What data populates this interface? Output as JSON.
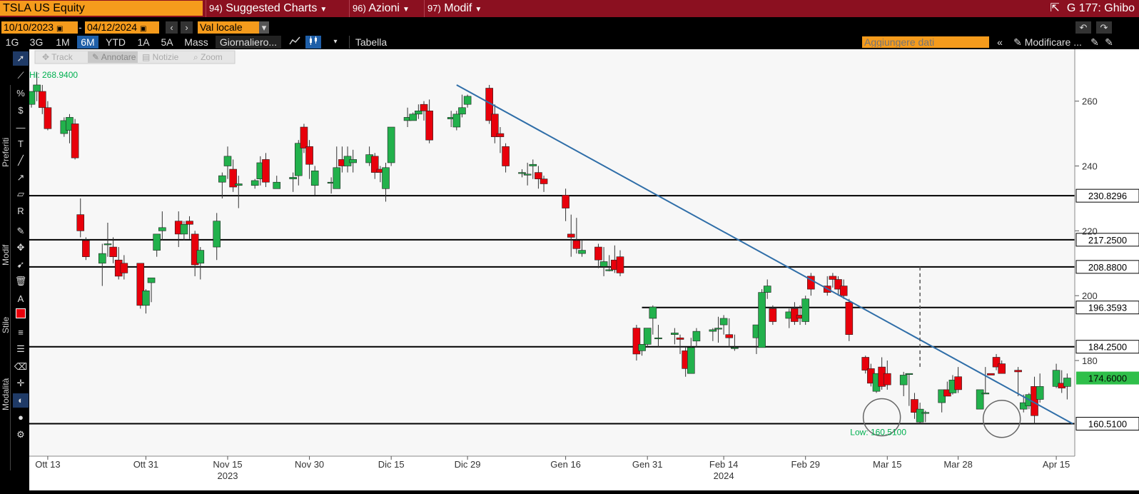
{
  "header": {
    "ticker": "TSLA US Equity",
    "menus": [
      {
        "num": "94)",
        "label": "Suggested Charts"
      },
      {
        "num": "96)",
        "label": "Azioni"
      },
      {
        "num": "97)",
        "label": "Modif"
      }
    ],
    "right_title": "G 177: Ghibo"
  },
  "toolbar": {
    "start_date": "10/10/2023",
    "end_date": "04/12/2024",
    "currency": "Val locale",
    "timeframes": [
      "1G",
      "3G",
      "1M",
      "6M",
      "YTD",
      "1A",
      "5A",
      "Mass"
    ],
    "active_timeframe": "6M",
    "period": "Giornaliero...",
    "table_label": "Tabella",
    "add_data_placeholder": "Aggiungere dati",
    "edit_label": "Modificare ..."
  },
  "annot_tools": [
    "Track",
    "Annotare",
    "Notizie",
    "Zoom"
  ],
  "side_labels": [
    "Preferiti",
    "Modif",
    "Stile",
    "Modalità"
  ],
  "chart_data": {
    "type": "candlestick",
    "x_ticks": [
      {
        "date": "2023-10-13",
        "label": "Ott 13"
      },
      {
        "date": "2023-10-31",
        "label": "Ott 31"
      },
      {
        "date": "2023-11-15",
        "label": "Nov 15"
      },
      {
        "date": "2023-11-30",
        "label": "Nov 30"
      },
      {
        "date": "2023-12-15",
        "label": "Dic 15"
      },
      {
        "date": "2023-12-29",
        "label": "Dic 29"
      },
      {
        "date": "2024-01-16",
        "label": "Gen 16"
      },
      {
        "date": "2024-01-31",
        "label": "Gen 31"
      },
      {
        "date": "2024-02-14",
        "label": "Feb 14"
      },
      {
        "date": "2024-02-29",
        "label": "Feb 29"
      },
      {
        "date": "2024-03-15",
        "label": "Mar 15"
      },
      {
        "date": "2024-03-28",
        "label": "Mar 28"
      },
      {
        "date": "2024-04-15",
        "label": "Apr 15"
      }
    ],
    "year_labels": [
      {
        "date": "2023-11-15",
        "label": "2023"
      },
      {
        "date": "2024-02-14",
        "label": "2024"
      }
    ],
    "y_ticks": [
      180,
      200,
      220,
      240,
      260
    ],
    "ylim": [
      150.5,
      276
    ],
    "xlim": [
      "2023-10-10",
      "2024-04-18"
    ],
    "hi_label": "Hi: 268.9400",
    "low_label": "Low: 160.5100",
    "h_lines": [
      {
        "value": 230.8296,
        "label": "230.8296"
      },
      {
        "value": 217.25,
        "label": "217.2500"
      },
      {
        "value": 208.88,
        "label": "208.8800"
      },
      {
        "value": 184.25,
        "label": "184.2500"
      },
      {
        "value": 160.51,
        "label": "160.5100"
      }
    ],
    "short_line": {
      "value": 196.3593,
      "label": "196.3593",
      "from": "2024-01-30"
    },
    "last_price": {
      "value": 174.6,
      "label": "174.6000"
    },
    "trendline": [
      {
        "date": "2023-12-27",
        "value": 265
      },
      {
        "date": "2024-04-18",
        "value": 160.51
      }
    ],
    "vline": {
      "date": "2024-03-21",
      "from": 208.88,
      "to": 177.5
    },
    "circles": [
      {
        "date": "2024-03-14",
        "value": 162.5
      },
      {
        "date": "2024-04-05",
        "value": 162
      }
    ],
    "candles": [
      {
        "d": "2023-10-10",
        "o": 259,
        "h": 263,
        "c": 263,
        "l": 258
      },
      {
        "d": "2023-10-11",
        "o": 263,
        "h": 268.94,
        "c": 265,
        "l": 260
      },
      {
        "d": "2023-10-12",
        "o": 263,
        "h": 265,
        "c": 258,
        "l": 256
      },
      {
        "d": "2023-10-13",
        "o": 258,
        "h": 260,
        "c": 251.5,
        "l": 251
      },
      {
        "d": "2023-10-16",
        "o": 250,
        "h": 255,
        "c": 254,
        "l": 249
      },
      {
        "d": "2023-10-17",
        "o": 251,
        "h": 256,
        "c": 255,
        "l": 247
      },
      {
        "d": "2023-10-18",
        "o": 253,
        "h": 254.5,
        "c": 242.5,
        "l": 242
      },
      {
        "d": "2023-10-19",
        "o": 225,
        "h": 230,
        "c": 220,
        "l": 218
      },
      {
        "d": "2023-10-20",
        "o": 217,
        "h": 218,
        "c": 212,
        "l": 211
      },
      {
        "d": "2023-10-23",
        "o": 210,
        "h": 216,
        "c": 213,
        "l": 203
      },
      {
        "d": "2023-10-24",
        "o": 216,
        "h": 222.5,
        "c": 216,
        "l": 212
      },
      {
        "d": "2023-10-25",
        "o": 215,
        "h": 218,
        "c": 212,
        "l": 210
      },
      {
        "d": "2023-10-26",
        "o": 211,
        "h": 215,
        "c": 206,
        "l": 205
      },
      {
        "d": "2023-10-27",
        "o": 210,
        "h": 212.5,
        "c": 207,
        "l": 205
      },
      {
        "d": "2023-10-30",
        "o": 210,
        "h": 210,
        "c": 197,
        "l": 196
      },
      {
        "d": "2023-10-31",
        "o": 197,
        "h": 202,
        "c": 201.5,
        "l": 194.5
      },
      {
        "d": "2023-11-01",
        "o": 204,
        "h": 205,
        "c": 205.5,
        "l": 198
      },
      {
        "d": "2023-11-02",
        "o": 214,
        "h": 219,
        "c": 219,
        "l": 212
      },
      {
        "d": "2023-11-03",
        "o": 220,
        "h": 226,
        "c": 221,
        "l": 217
      },
      {
        "d": "2023-11-06",
        "o": 223,
        "h": 226,
        "c": 219,
        "l": 215
      },
      {
        "d": "2023-11-07",
        "o": 219,
        "h": 223,
        "c": 222,
        "l": 217
      },
      {
        "d": "2023-11-08",
        "o": 223,
        "h": 224.5,
        "c": 222,
        "l": 217.5
      },
      {
        "d": "2023-11-09",
        "o": 219,
        "h": 220,
        "c": 209.5,
        "l": 206
      },
      {
        "d": "2023-11-10",
        "o": 210,
        "h": 215,
        "c": 214,
        "l": 205
      },
      {
        "d": "2023-11-13",
        "o": 215,
        "h": 225.5,
        "c": 223,
        "l": 211
      },
      {
        "d": "2023-11-14",
        "o": 235,
        "h": 238,
        "c": 237,
        "l": 230
      },
      {
        "d": "2023-11-15",
        "o": 240,
        "h": 246,
        "c": 243,
        "l": 236
      },
      {
        "d": "2023-11-16",
        "o": 239,
        "h": 242,
        "c": 233.5,
        "l": 232
      },
      {
        "d": "2023-11-17",
        "o": 234,
        "h": 237,
        "c": 234.5,
        "l": 227
      },
      {
        "d": "2023-11-20",
        "o": 234,
        "h": 236,
        "c": 235.5,
        "l": 233
      },
      {
        "d": "2023-11-21",
        "o": 236,
        "h": 243,
        "c": 241,
        "l": 234
      },
      {
        "d": "2023-11-22",
        "o": 242,
        "h": 244,
        "c": 235,
        "l": 233.5
      },
      {
        "d": "2023-11-24",
        "o": 233,
        "h": 237,
        "c": 235,
        "l": 233
      },
      {
        "d": "2023-11-27",
        "o": 236,
        "h": 238,
        "c": 236.5,
        "l": 232
      },
      {
        "d": "2023-11-28",
        "o": 237,
        "h": 248,
        "c": 247,
        "l": 234
      },
      {
        "d": "2023-11-29",
        "o": 252,
        "h": 253,
        "c": 245.5,
        "l": 244
      },
      {
        "d": "2023-11-30",
        "o": 246,
        "h": 248,
        "c": 240.5,
        "l": 236
      },
      {
        "d": "2023-12-01",
        "o": 234,
        "h": 240,
        "c": 238.5,
        "l": 231
      },
      {
        "d": "2023-12-04",
        "o": 235,
        "h": 236.5,
        "c": 235,
        "l": 231.5
      },
      {
        "d": "2023-12-05",
        "o": 233,
        "h": 246,
        "c": 239.5,
        "l": 233
      },
      {
        "d": "2023-12-06",
        "o": 242,
        "h": 246,
        "c": 240,
        "l": 238
      },
      {
        "d": "2023-12-07",
        "o": 240,
        "h": 246,
        "c": 243,
        "l": 238
      },
      {
        "d": "2023-12-08",
        "o": 241,
        "h": 245,
        "c": 242,
        "l": 238
      },
      {
        "d": "2023-12-11",
        "o": 241,
        "h": 246,
        "c": 243.5,
        "l": 240
      },
      {
        "d": "2023-12-12",
        "o": 243,
        "h": 244,
        "c": 238,
        "l": 236
      },
      {
        "d": "2023-12-13",
        "o": 239,
        "h": 240,
        "c": 238,
        "l": 235
      },
      {
        "d": "2023-12-14",
        "o": 233,
        "h": 241,
        "c": 239.5,
        "l": 229
      },
      {
        "d": "2023-12-15",
        "o": 241,
        "h": 252,
        "c": 252,
        "l": 240
      },
      {
        "d": "2023-12-18",
        "o": 254,
        "h": 258,
        "c": 255,
        "l": 252
      },
      {
        "d": "2023-12-19",
        "o": 254,
        "h": 256.5,
        "c": 256,
        "l": 254
      },
      {
        "d": "2023-12-20",
        "o": 256,
        "h": 259,
        "c": 257,
        "l": 254.5
      },
      {
        "d": "2023-12-21",
        "o": 259,
        "h": 260,
        "c": 257,
        "l": 254
      },
      {
        "d": "2023-12-22",
        "o": 257,
        "h": 260.5,
        "c": 248,
        "l": 247
      },
      {
        "d": "2023-12-26",
        "o": 254.5,
        "h": 257,
        "c": 255,
        "l": 252
      },
      {
        "d": "2023-12-27",
        "o": 252,
        "h": 257,
        "c": 256,
        "l": 251
      },
      {
        "d": "2023-12-28",
        "o": 256,
        "h": 262,
        "c": 258,
        "l": 255
      },
      {
        "d": "2023-12-29",
        "o": 259,
        "h": 262,
        "c": 261.5,
        "l": 258
      },
      {
        "d": "2024-01-02",
        "o": 264,
        "h": 265,
        "c": 254,
        "l": 253
      },
      {
        "d": "2024-01-03",
        "o": 256,
        "h": 259,
        "c": 249,
        "l": 247
      },
      {
        "d": "2024-01-04",
        "o": 250,
        "h": 252,
        "c": 249,
        "l": 244
      },
      {
        "d": "2024-01-05",
        "o": 246,
        "h": 247,
        "c": 240,
        "l": 238
      },
      {
        "d": "2024-01-08",
        "o": 238,
        "h": 239,
        "c": 238,
        "l": 236.5
      },
      {
        "d": "2024-01-09",
        "o": 237.5,
        "h": 241,
        "c": 237.5,
        "l": 234
      },
      {
        "d": "2024-01-10",
        "o": 240,
        "h": 242,
        "c": 240.5,
        "l": 236
      },
      {
        "d": "2024-01-11",
        "o": 238,
        "h": 240,
        "c": 236,
        "l": 233
      },
      {
        "d": "2024-01-12",
        "o": 236,
        "h": 237,
        "c": 234.5,
        "l": 232
      },
      {
        "d": "2024-01-16",
        "o": 231,
        "h": 233,
        "c": 227,
        "l": 223
      },
      {
        "d": "2024-01-17",
        "o": 219,
        "h": 225,
        "c": 218,
        "l": 212
      },
      {
        "d": "2024-01-18",
        "o": 217,
        "h": 224,
        "c": 214.5,
        "l": 213
      },
      {
        "d": "2024-01-19",
        "o": 213,
        "h": 217,
        "c": 214,
        "l": 212
      },
      {
        "d": "2024-01-22",
        "o": 215,
        "h": 216,
        "c": 211,
        "l": 208.5
      },
      {
        "d": "2024-01-23",
        "o": 209,
        "h": 215,
        "c": 210.5,
        "l": 206
      },
      {
        "d": "2024-01-24",
        "o": 208,
        "h": 212.5,
        "c": 208,
        "l": 207.5
      },
      {
        "d": "2024-01-25",
        "o": 211,
        "h": 215.5,
        "c": 208,
        "l": 207
      },
      {
        "d": "2024-01-26",
        "o": 212,
        "h": 214,
        "c": 207,
        "l": 206
      },
      {
        "d": "2024-01-29",
        "o": 190,
        "h": 191,
        "c": 182,
        "l": 180
      },
      {
        "d": "2024-01-30",
        "o": 183,
        "h": 185,
        "c": 185,
        "l": 181.5
      },
      {
        "d": "2024-01-31",
        "o": 185,
        "h": 190,
        "c": 190,
        "l": 184
      },
      {
        "d": "2024-02-01",
        "o": 193,
        "h": 197,
        "c": 196.5,
        "l": 188
      },
      {
        "d": "2024-02-02",
        "o": 187,
        "h": 191,
        "c": 187,
        "l": 184
      },
      {
        "d": "2024-02-05",
        "o": 188,
        "h": 190,
        "c": 188.5,
        "l": 185
      },
      {
        "d": "2024-02-06",
        "o": 187,
        "h": 188,
        "c": 186.5,
        "l": 182
      },
      {
        "d": "2024-02-07",
        "o": 183,
        "h": 184,
        "c": 177.5,
        "l": 175
      },
      {
        "d": "2024-02-08",
        "o": 176,
        "h": 187,
        "c": 184,
        "l": 176
      },
      {
        "d": "2024-02-09",
        "o": 186,
        "h": 190,
        "c": 189,
        "l": 184
      },
      {
        "d": "2024-02-12",
        "o": 189,
        "h": 190,
        "c": 189.5,
        "l": 186
      },
      {
        "d": "2024-02-13",
        "o": 190,
        "h": 193.5,
        "c": 190,
        "l": 185.5
      },
      {
        "d": "2024-02-14",
        "o": 191,
        "h": 194,
        "c": 193,
        "l": 188
      },
      {
        "d": "2024-02-15",
        "o": 188,
        "h": 193,
        "c": 187,
        "l": 184
      },
      {
        "d": "2024-02-16",
        "o": 184,
        "h": 188,
        "c": 184,
        "l": 183
      },
      {
        "d": "2024-02-20",
        "o": 187,
        "h": 191,
        "c": 191,
        "l": 182
      },
      {
        "d": "2024-02-21",
        "o": 184,
        "h": 202,
        "c": 201,
        "l": 184
      },
      {
        "d": "2024-02-22",
        "o": 201,
        "h": 205,
        "c": 203,
        "l": 199
      },
      {
        "d": "2024-02-23",
        "o": 196,
        "h": 197,
        "c": 192,
        "l": 191
      },
      {
        "d": "2024-02-26",
        "o": 193,
        "h": 196,
        "c": 195,
        "l": 190
      },
      {
        "d": "2024-02-27",
        "o": 196,
        "h": 198,
        "c": 192,
        "l": 191
      },
      {
        "d": "2024-02-28",
        "o": 194,
        "h": 197,
        "c": 193,
        "l": 191
      },
      {
        "d": "2024-02-29",
        "o": 192,
        "h": 200,
        "c": 199,
        "l": 191
      },
      {
        "d": "2024-03-01",
        "o": 206,
        "h": 207,
        "c": 202,
        "l": 200
      },
      {
        "d": "2024-03-04",
        "o": 203,
        "h": 206,
        "c": 201,
        "l": 200
      },
      {
        "d": "2024-03-05",
        "o": 206,
        "h": 207,
        "c": 205,
        "l": 202.5
      },
      {
        "d": "2024-03-06",
        "o": 205,
        "h": 206,
        "c": 202,
        "l": 200
      },
      {
        "d": "2024-03-07",
        "o": 203,
        "h": 205,
        "c": 200,
        "l": 199
      },
      {
        "d": "2024-03-08",
        "o": 198,
        "h": 199,
        "c": 188,
        "l": 186
      },
      {
        "d": "2024-03-11",
        "o": 181,
        "h": 181.5,
        "c": 177,
        "l": 176
      },
      {
        "d": "2024-03-12",
        "o": 177.5,
        "h": 179,
        "c": 173,
        "l": 172
      },
      {
        "d": "2024-03-13",
        "o": 170.5,
        "h": 176,
        "c": 176,
        "l": 170
      },
      {
        "d": "2024-03-14",
        "o": 178,
        "h": 181,
        "c": 172,
        "l": 171
      },
      {
        "d": "2024-03-15",
        "o": 176,
        "h": 180,
        "c": 172.5,
        "l": 171
      },
      {
        "d": "2024-03-18",
        "o": 172.5,
        "h": 176.5,
        "c": 175.5,
        "l": 169
      },
      {
        "d": "2024-03-19",
        "o": 176,
        "h": 176,
        "c": 176,
        "l": 166
      },
      {
        "d": "2024-03-20",
        "o": 168,
        "h": 170,
        "c": 164,
        "l": 162
      },
      {
        "d": "2024-03-21",
        "o": 161,
        "h": 167,
        "c": 165,
        "l": 160.51
      },
      {
        "d": "2024-03-22",
        "o": 164,
        "h": 164.5,
        "c": 164,
        "l": 161
      },
      {
        "d": "2024-03-25",
        "o": 167,
        "h": 171,
        "c": 171,
        "l": 164
      },
      {
        "d": "2024-03-26",
        "o": 171,
        "h": 173.5,
        "c": 169,
        "l": 169
      },
      {
        "d": "2024-03-27",
        "o": 170,
        "h": 175.5,
        "c": 174,
        "l": 169.5
      },
      {
        "d": "2024-03-28",
        "o": 175,
        "h": 178,
        "c": 171,
        "l": 170
      },
      {
        "d": "2024-04-01",
        "o": 165,
        "h": 166,
        "c": 171,
        "l": 165
      },
      {
        "d": "2024-04-02",
        "o": 170,
        "h": 178,
        "c": 170,
        "l": 170
      },
      {
        "d": "2024-04-03",
        "o": 176,
        "h": 177,
        "c": 175.5,
        "l": 177
      },
      {
        "d": "2024-04-04",
        "o": 181,
        "h": 182,
        "c": 178,
        "l": 177
      },
      {
        "d": "2024-04-05",
        "o": 179,
        "h": 180,
        "c": 176,
        "l": 176
      },
      {
        "d": "2024-04-08",
        "o": 177,
        "h": 178,
        "c": 176.5,
        "l": 169
      },
      {
        "d": "2024-04-09",
        "o": 165,
        "h": 169.5,
        "c": 167,
        "l": 164
      },
      {
        "d": "2024-04-10",
        "o": 166,
        "h": 170,
        "c": 169.5,
        "l": 165
      },
      {
        "d": "2024-04-11",
        "o": 172,
        "h": 175,
        "c": 163,
        "l": 160.5
      },
      {
        "d": "2024-04-12",
        "o": 168,
        "h": 176,
        "c": 172,
        "l": 167
      },
      {
        "d": "2024-04-15",
        "o": 172,
        "h": 179,
        "c": 177,
        "l": 171.5
      },
      {
        "d": "2024-04-16",
        "o": 173,
        "h": 177,
        "c": 171.5,
        "l": 170
      },
      {
        "d": "2024-04-17",
        "o": 172,
        "h": 176,
        "c": 174.6,
        "l": 168
      }
    ]
  },
  "colors": {
    "up": "#22b14c",
    "down": "#e8000b",
    "trendline": "#2f6ea8",
    "accent": "#f59b1c",
    "brand": "#8b1020",
    "label_green": "#00b050"
  }
}
